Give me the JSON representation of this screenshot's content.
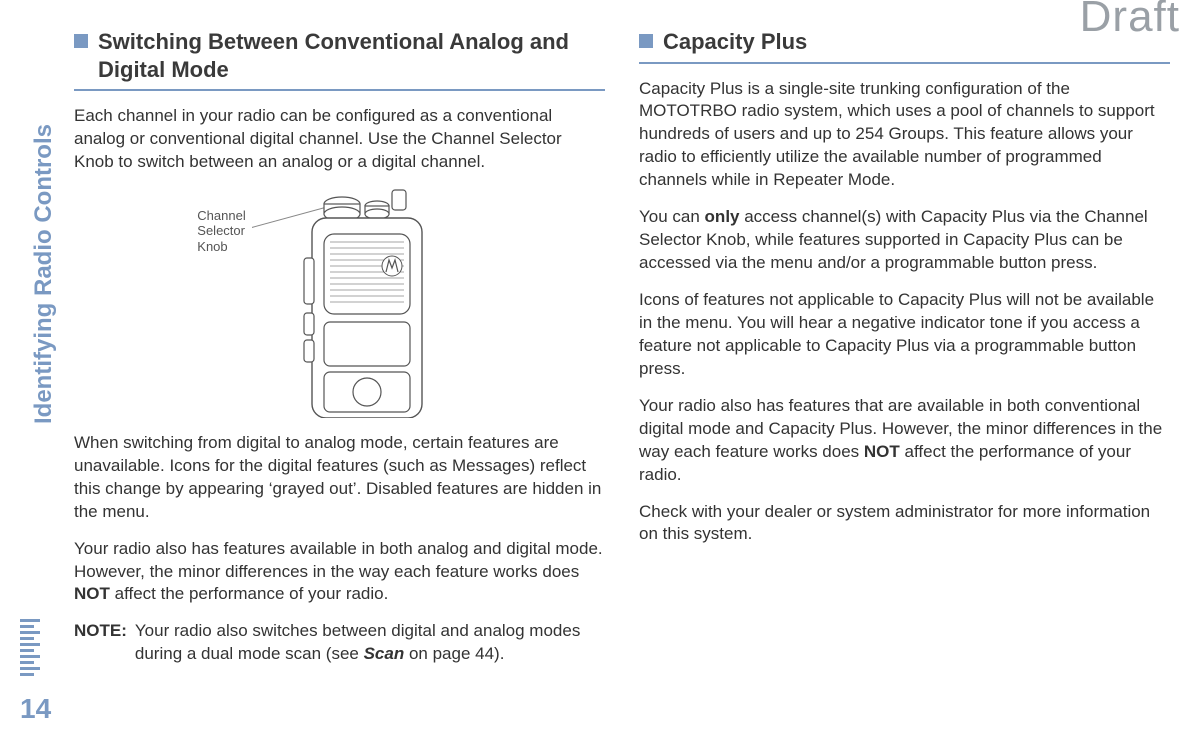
{
  "watermark": "Draft",
  "sidebar": {
    "label": "Identifying Radio Controls",
    "page_number": "14"
  },
  "left": {
    "heading": "Switching Between Conventional Analog and Digital Mode",
    "p1": "Each channel in your radio can be configured as a conventional analog or conventional digital channel. Use the Channel Selector Knob to switch between an analog or a digital channel.",
    "callout_l1": "Channel",
    "callout_l2": "Selector",
    "callout_l3": "Knob",
    "p2": "When switching from digital to analog mode, certain features are unavailable. Icons for the digital features (such as Messages) reflect this change by appearing ‘grayed out’. Disabled features are hidden in the menu.",
    "p3_pre": "Your radio also has features available in both analog and digital mode. However, the minor differences in the way each feature works does ",
    "p3_bold": "NOT",
    "p3_post": " affect the performance of your radio.",
    "note_label": "NOTE:",
    "note_pre": "Your radio also switches between digital and analog modes during a dual mode scan (see ",
    "note_bold": "Scan",
    "note_post": " on page 44)."
  },
  "right": {
    "heading": "Capacity Plus",
    "p1": "Capacity Plus is a single-site trunking configuration of the MOTOTRBO radio system, which uses a pool of channels to support hundreds of users and up to 254 Groups. This feature allows your radio to efficiently utilize the available number of programmed channels while in Repeater Mode.",
    "p2_pre": "You can ",
    "p2_bold": "only",
    "p2_post": " access channel(s) with Capacity Plus via the Channel Selector Knob, while features supported in Capacity Plus can be accessed via the menu and/or a programmable button press.",
    "p3": "Icons of features not applicable to Capacity Plus will not be available in the menu. You will hear a negative indicator tone if you access a feature not applicable to Capacity Plus via a programmable button press.",
    "p4_pre": "Your radio also has features that are available in both conventional digital mode and Capacity Plus. However, the minor differences in the way each feature works does ",
    "p4_bold": "NOT",
    "p4_post": " affect the performance of your radio.",
    "p5": "Check with your dealer or system administrator for more information on this system."
  }
}
